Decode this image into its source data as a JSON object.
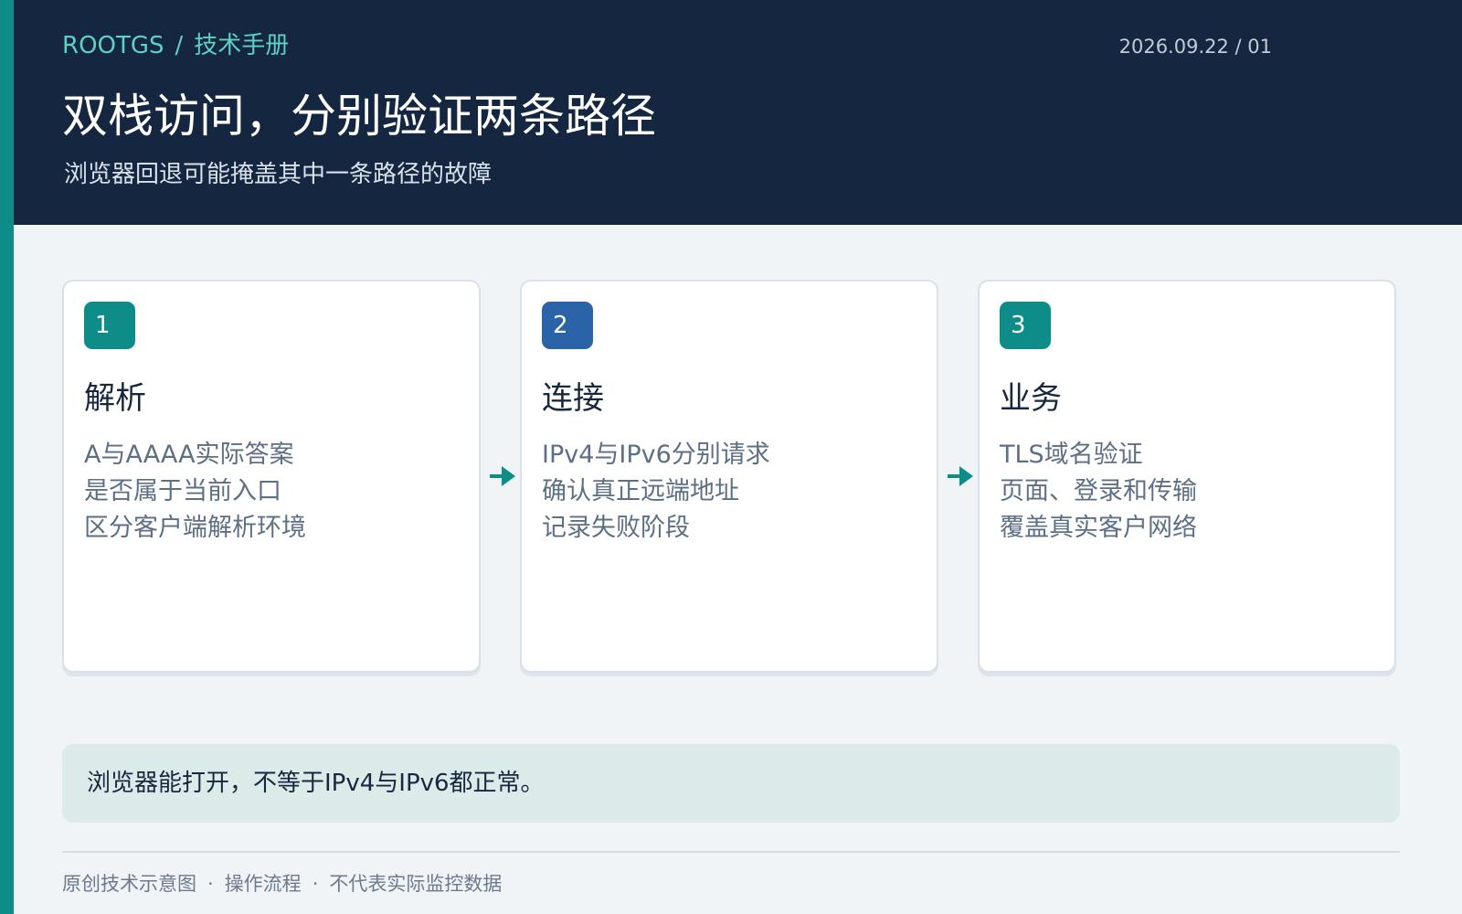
{
  "header": {
    "brand": "ROOTGS",
    "separator": "/",
    "section": "技术手册",
    "meta": "2026.09.22 / 01",
    "title": "双栈访问，分别验证两条路径",
    "subtitle": "浏览器回退可能掩盖其中一条路径的故障"
  },
  "steps": [
    {
      "number": "1",
      "title": "解析",
      "lines": [
        "A与AAAA实际答案",
        "是否属于当前入口",
        "区分客户端解析环境"
      ]
    },
    {
      "number": "2",
      "title": "连接",
      "lines": [
        "IPv4与IPv6分别请求",
        "确认真正远端地址",
        "记录失败阶段"
      ]
    },
    {
      "number": "3",
      "title": "业务",
      "lines": [
        "TLS域名验证",
        "页面、登录和传输",
        "覆盖真实客户网络"
      ]
    }
  ],
  "callout": {
    "text": "浏览器能打开，不等于IPv4与IPv6都正常。"
  },
  "footer": {
    "items": [
      "原创技术示意图",
      "操作流程",
      "不代表实际监控数据"
    ],
    "separator": "·"
  },
  "colors": {
    "accent": "#0e8c88",
    "header_bg": "#142640",
    "step2": "#2b63a8",
    "callout_bg": "#dcebea"
  },
  "icons": {
    "flow_arrow": "arrow-right-icon"
  }
}
